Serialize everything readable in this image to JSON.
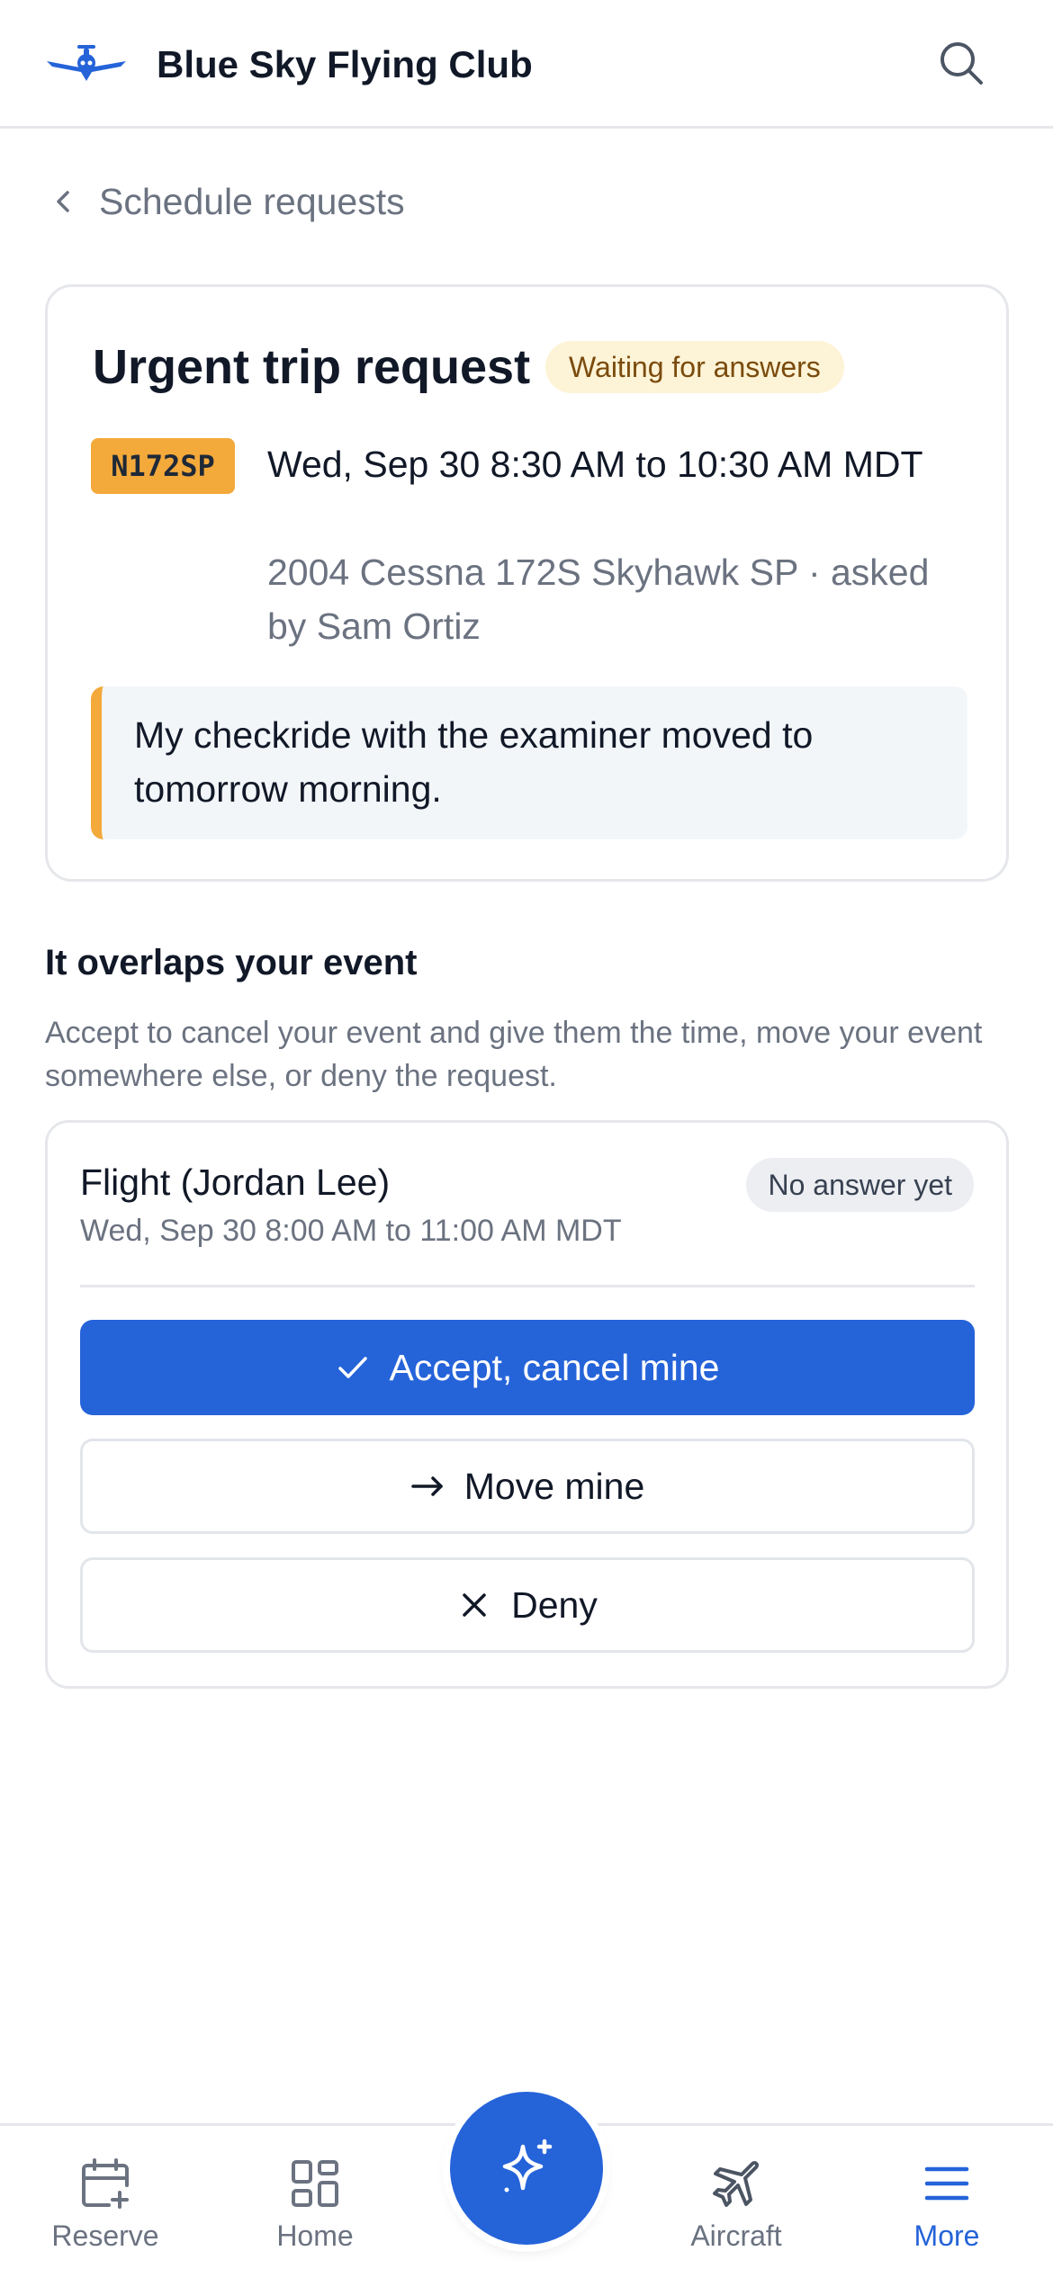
{
  "header": {
    "title": "Blue Sky Flying Club",
    "logo_icon": "airplane-logo-icon",
    "search_icon": "search-icon"
  },
  "back_link": {
    "label": "Schedule requests"
  },
  "request": {
    "title": "Urgent trip request",
    "status": "Waiting for answers",
    "tail_number": "N172SP",
    "time": "Wed, Sep 30 8:30 AM to 10:30 AM MDT",
    "meta": "2004 Cessna 172S Skyhawk SP · asked by Sam Ortiz",
    "note": "My checkride with the examiner moved to tomorrow morning."
  },
  "overlap": {
    "title": "It overlaps your event",
    "description": "Accept to cancel your event and give them the time, move your event somewhere else, or deny the request.",
    "event": {
      "name": "Flight (Jordan Lee)",
      "time": "Wed, Sep 30 8:00 AM to 11:00 AM MDT",
      "answer_status": "No answer yet"
    },
    "actions": {
      "accept": "Accept, cancel mine",
      "move": "Move mine",
      "deny": "Deny"
    }
  },
  "bottom_nav": {
    "items": [
      {
        "label": "Reserve",
        "icon": "calendar-plus-icon"
      },
      {
        "label": "Home",
        "icon": "grid-icon"
      },
      {
        "label": "Aircraft",
        "icon": "airplane-icon"
      },
      {
        "label": "More",
        "icon": "menu-icon",
        "active": true
      }
    ],
    "fab_icon": "sparkle-icon"
  },
  "colors": {
    "accent": "#2563d9",
    "badge": "#f4a93b",
    "status_bg": "#fdf3d6",
    "text_muted": "#6b7280"
  }
}
